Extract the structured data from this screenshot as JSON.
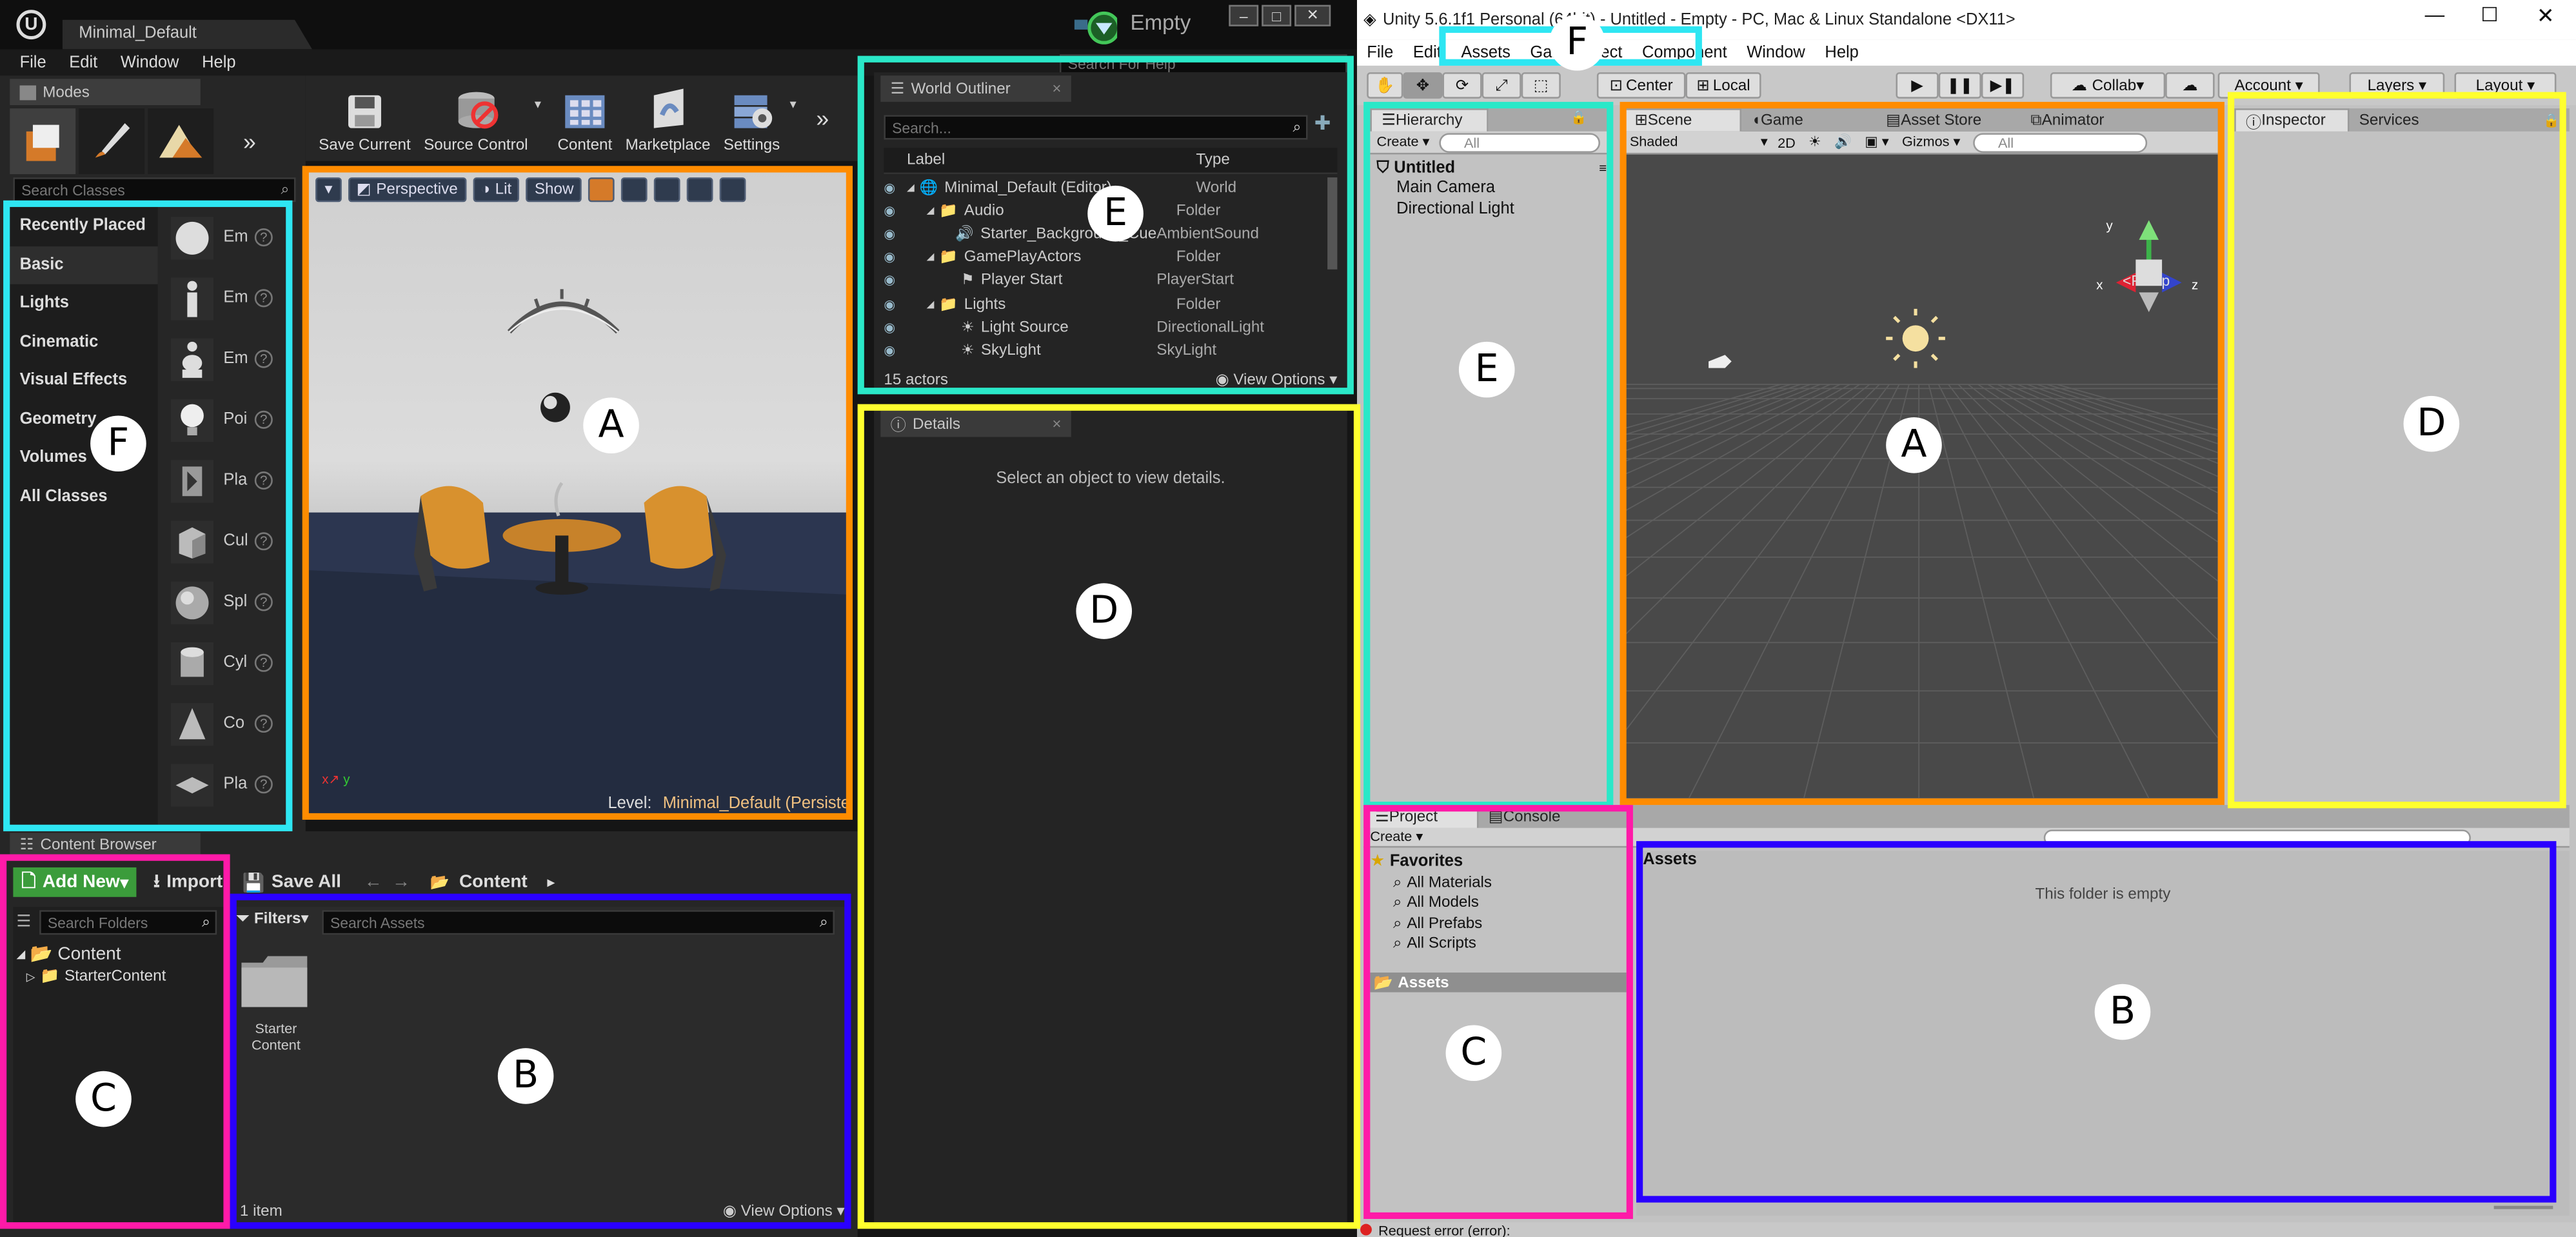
{
  "ue": {
    "title_tab": "Minimal_Default",
    "project_name": "Empty",
    "help_search_placeholder": "Search For Help",
    "menu": [
      "File",
      "Edit",
      "Window",
      "Help"
    ],
    "modes_tab": "Modes",
    "search_classes_placeholder": "Search Classes",
    "categories": [
      "Recently Placed",
      "Basic",
      "Lights",
      "Cinematic",
      "Visual Effects",
      "Geometry",
      "Volumes",
      "All Classes"
    ],
    "placeables": [
      "Em",
      "Em",
      "Em",
      "Poi",
      "Pla",
      "Cul",
      "Spl",
      "Cyl",
      "Co",
      "Pla"
    ],
    "toolbar": [
      {
        "label": "Save Current",
        "icon": "save-icon"
      },
      {
        "label": "Source Control",
        "icon": "source-control-icon"
      },
      {
        "label": "Content",
        "icon": "content-icon"
      },
      {
        "label": "Marketplace",
        "icon": "marketplace-icon"
      },
      {
        "label": "Settings",
        "icon": "settings-icon"
      }
    ],
    "viewport": {
      "perspective": "Perspective",
      "lit": "Lit",
      "show": "Show",
      "level_label": "Level:",
      "level_name": "Minimal_Default (Persisten"
    },
    "outliner": {
      "tab": "World Outliner",
      "search_placeholder": "Search...",
      "col_label": "Label",
      "col_type": "Type",
      "rows": [
        {
          "label": "Minimal_Default (Editor)",
          "type": "World",
          "indent": 0,
          "kind": "world"
        },
        {
          "label": "Audio",
          "type": "Folder",
          "indent": 1,
          "kind": "folder"
        },
        {
          "label": "Starter_Background_Cue",
          "type": "AmbientSound",
          "indent": 2,
          "kind": "sound"
        },
        {
          "label": "GamePlayActors",
          "type": "Folder",
          "indent": 1,
          "kind": "folder"
        },
        {
          "label": "Player Start",
          "type": "PlayerStart",
          "indent": 2,
          "kind": "actor"
        },
        {
          "label": "Lights",
          "type": "Folder",
          "indent": 1,
          "kind": "folder"
        },
        {
          "label": "Light Source",
          "type": "DirectionalLight",
          "indent": 2,
          "kind": "light"
        },
        {
          "label": "SkyLight",
          "type": "SkyLight",
          "indent": 2,
          "kind": "light"
        }
      ],
      "actor_count": "15 actors",
      "view_options": "View Options"
    },
    "details": {
      "tab": "Details",
      "empty_message": "Select an object to view details."
    },
    "content_browser": {
      "tab": "Content Browser",
      "add_new": "Add New",
      "import": "Import",
      "save_all": "Save All",
      "path": "Content",
      "search_folders_placeholder": "Search Folders",
      "filters": "Filters",
      "search_assets_placeholder": "Search Assets",
      "tree_root": "Content",
      "tree_child": "StarterContent",
      "asset_name_1": "Starter",
      "asset_name_2": "Content",
      "item_count": "1 item",
      "view_options": "View Options"
    }
  },
  "unity": {
    "title": "Unity 5.6.1f1 Personal (64bit) - Untitled - Empty - PC, Mac & Linux Standalone <DX11>",
    "menu": [
      "File",
      "Edit",
      "Assets",
      "GameObject",
      "Component",
      "Window",
      "Help"
    ],
    "toolbar": {
      "center": "Center",
      "local": "Local",
      "collab": "Collab",
      "account": "Account",
      "layers": "Layers",
      "layout": "Layout"
    },
    "hierarchy": {
      "tab": "Hierarchy",
      "create": "Create",
      "search": "All",
      "scene": "Untitled",
      "items": [
        "Main Camera",
        "Directional Light"
      ]
    },
    "scene_tabs": [
      "Scene",
      "Game",
      "Asset Store",
      "Animator"
    ],
    "scene_toolbar": {
      "shaded": "Shaded",
      "mode_2d": "2D",
      "gizmos": "Gizmos",
      "search": "All",
      "persp": "Persp"
    },
    "inspector_tabs": [
      "Inspector",
      "Services"
    ],
    "project": {
      "tabs": [
        "Project",
        "Console"
      ],
      "create": "Create",
      "favorites": "Favorites",
      "favorites_items": [
        "All Materials",
        "All Models",
        "All Prefabs",
        "All Scripts"
      ],
      "assets_folder": "Assets",
      "assets_header": "Assets",
      "empty_message": "This folder is empty"
    },
    "status": "Request error (error):"
  },
  "annotations": {
    "colors": {
      "A": "#ff8c00",
      "B": "#2a00ff",
      "C": "#ff1aa8",
      "D": "#ffff2e",
      "E": "#2ae8c8",
      "F": "#2ee6f2"
    },
    "labels": [
      "A",
      "B",
      "C",
      "D",
      "E",
      "F"
    ]
  }
}
